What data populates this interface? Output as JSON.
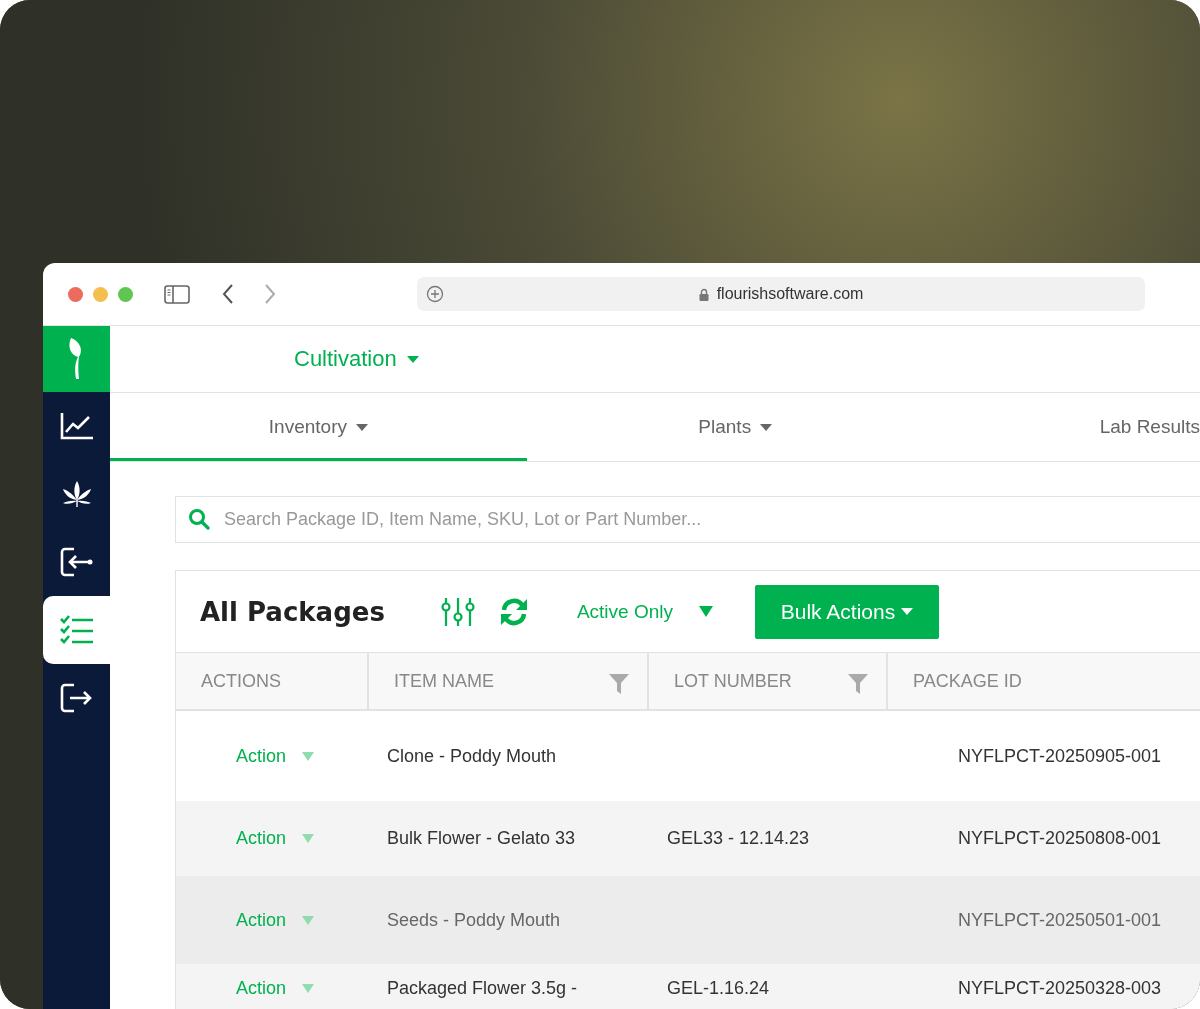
{
  "browser": {
    "url": "flourishsoftware.com"
  },
  "sidebar": {
    "items": [
      {
        "kind": "logo",
        "selected": false
      },
      {
        "kind": "chart",
        "selected": false
      },
      {
        "kind": "leaf",
        "selected": false
      },
      {
        "kind": "login",
        "selected": false
      },
      {
        "kind": "checklist",
        "selected": true
      },
      {
        "kind": "logout",
        "selected": false
      }
    ]
  },
  "module": {
    "label": "Cultivation"
  },
  "tabs": [
    {
      "label": "Inventory",
      "selected": true,
      "caret": true
    },
    {
      "label": "Plants",
      "selected": false,
      "caret": true
    },
    {
      "label": "Lab Results",
      "selected": false,
      "caret": false
    }
  ],
  "search": {
    "placeholder": "Search Package ID, Item Name, SKU, Lot or Part Number..."
  },
  "panel": {
    "title": "All Packages",
    "filter": "Active Only",
    "bulk_button": "Bulk Actions"
  },
  "table": {
    "columns": [
      {
        "label": "ACTIONS",
        "filter": false
      },
      {
        "label": "ITEM NAME",
        "filter": true
      },
      {
        "label": "LOT NUMBER",
        "filter": true
      },
      {
        "label": "PACKAGE ID",
        "filter": false
      }
    ],
    "rows": [
      {
        "action": "Action",
        "item": "Clone - Poddy Mouth",
        "lot": "",
        "package_id": "NYFLPCT-20250905-001",
        "selected": false
      },
      {
        "action": "Action",
        "item": "Bulk Flower - Gelato 33",
        "lot": "GEL33 - 12.14.23",
        "package_id": "NYFLPCT-20250808-001",
        "selected": false
      },
      {
        "action": "Action",
        "item": "Seeds - Poddy Mouth",
        "lot": "",
        "package_id": "NYFLPCT-20250501-001",
        "selected": true
      },
      {
        "action": "Action",
        "item": "Packaged Flower 3.5g -",
        "lot": "GEL-1.16.24",
        "package_id": "NYFLPCT-20250328-003",
        "selected": false
      }
    ]
  }
}
